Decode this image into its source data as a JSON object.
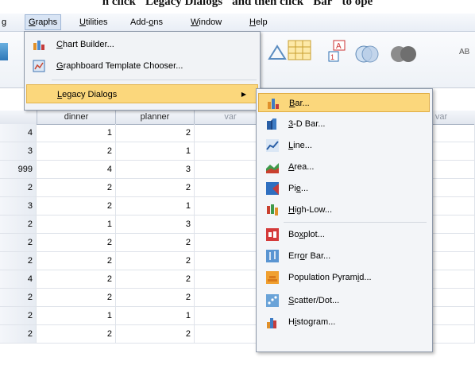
{
  "caption": "n click \"Legacy Dialogs\" and then click \"Bar\" to ope",
  "menubar": {
    "items": [
      {
        "label": "g",
        "mn": "",
        "rest": ""
      },
      {
        "label": "",
        "mn": "G",
        "rest": "raphs"
      },
      {
        "label": "",
        "mn": "U",
        "rest": "tilities"
      },
      {
        "label": "Add-",
        "mn": "o",
        "rest": "ns"
      },
      {
        "label": "",
        "mn": "W",
        "rest": "indow"
      },
      {
        "label": "",
        "mn": "H",
        "rest": "elp"
      }
    ]
  },
  "graphs_menu": {
    "items": [
      {
        "mn": "C",
        "rest": "hart Builder...",
        "icon": "chart-builder-icon"
      },
      {
        "mn": "G",
        "rest": "raphboard Template Chooser...",
        "icon": "graphboard-icon"
      },
      {
        "mn": "L",
        "rest": "egacy Dialogs",
        "icon": "",
        "arrow": "▶"
      }
    ]
  },
  "legacy_menu": {
    "items": [
      {
        "mn": "B",
        "rest": "ar...",
        "icon": "bar-chart-icon",
        "pre": ""
      },
      {
        "mn": "3",
        "rest": "-D Bar...",
        "icon": "3d-bar-chart-icon",
        "pre": ""
      },
      {
        "mn": "L",
        "rest": "ine...",
        "icon": "line-chart-icon",
        "pre": ""
      },
      {
        "mn": "A",
        "rest": "rea...",
        "icon": "area-chart-icon",
        "pre": ""
      },
      {
        "pre": "Pi",
        "mn": "e",
        "rest": "...",
        "icon": "pie-chart-icon"
      },
      {
        "mn": "H",
        "rest": "igh-Low...",
        "icon": "high-low-chart-icon",
        "pre": ""
      },
      {
        "pre": "Bo",
        "mn": "x",
        "rest": "plot...",
        "icon": "boxplot-icon"
      },
      {
        "pre": "Err",
        "mn": "o",
        "rest": "r Bar...",
        "icon": "error-bar-icon"
      },
      {
        "pre": "Population Pyram",
        "mn": "i",
        "rest": "d...",
        "icon": "population-pyramid-icon"
      },
      {
        "mn": "S",
        "rest": "catter/Dot...",
        "icon": "scatter-dot-icon",
        "pre": ""
      },
      {
        "pre": "H",
        "mn": "i",
        "rest": "stogram...",
        "icon": "histogram-icon"
      }
    ]
  },
  "grid": {
    "columns": [
      "dinner",
      "planner",
      "var",
      "var",
      "var"
    ],
    "rows": [
      [
        "4",
        "1",
        "2"
      ],
      [
        "3",
        "2",
        "1"
      ],
      [
        "999",
        "4",
        "3"
      ],
      [
        "2",
        "2",
        "2"
      ],
      [
        "3",
        "2",
        "1"
      ],
      [
        "2",
        "1",
        "3"
      ],
      [
        "2",
        "2",
        "2"
      ],
      [
        "2",
        "2",
        "2"
      ],
      [
        "4",
        "2",
        "2"
      ],
      [
        "2",
        "2",
        "2"
      ],
      [
        "2",
        "1",
        "1"
      ],
      [
        "2",
        "2",
        "2"
      ]
    ]
  },
  "colors": {
    "highlight": "#fbd77c",
    "menu_bg": "#f1f3f6"
  }
}
